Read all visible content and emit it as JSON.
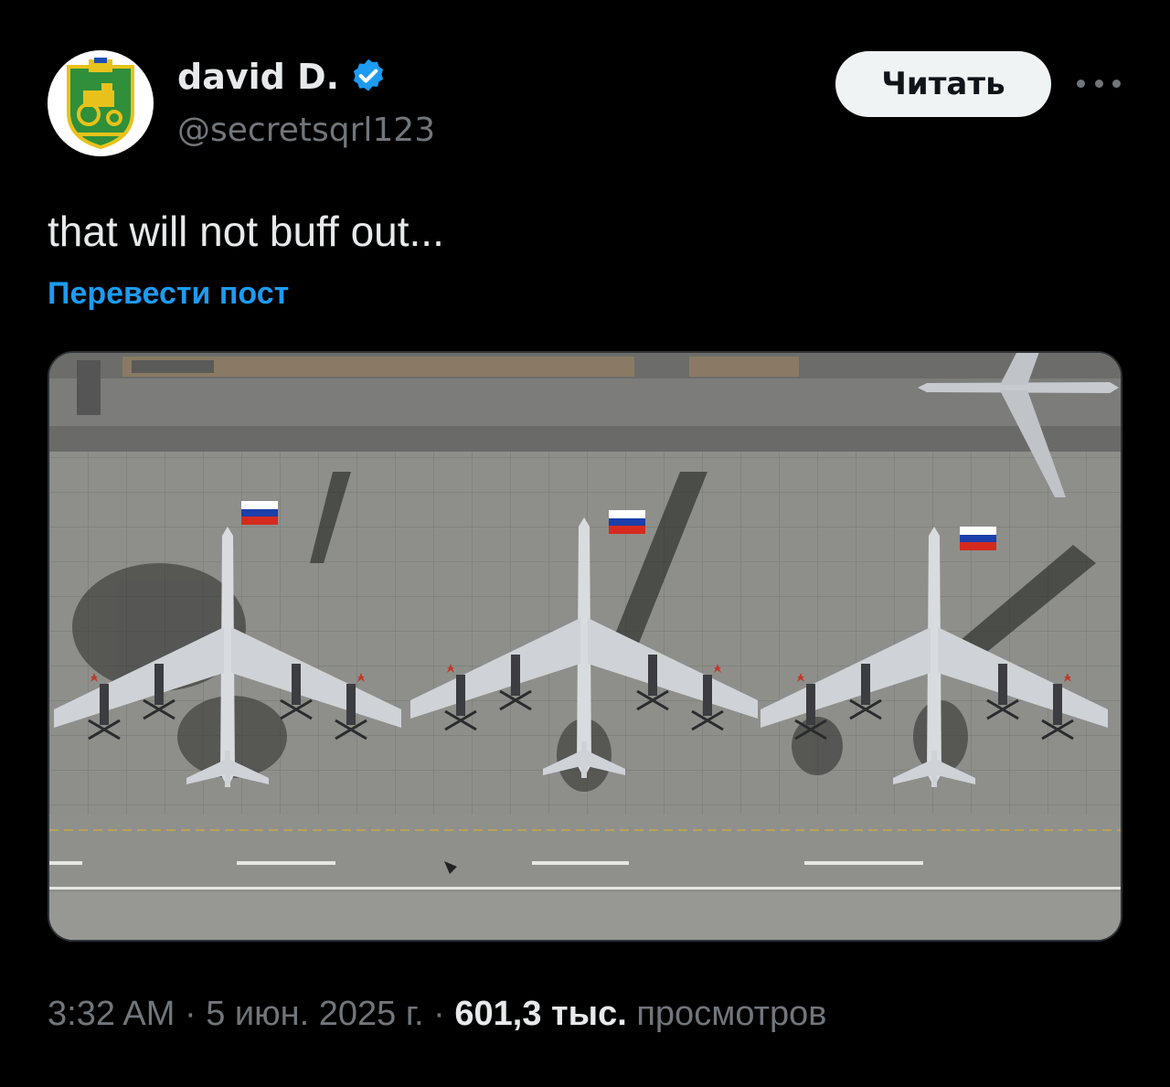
{
  "author": {
    "name": "david D.",
    "handle": "@secretsqrl123",
    "verified_color": "#1d9bf0"
  },
  "follow_button": {
    "label": "Читать"
  },
  "more_button": {
    "icon": "more-horizontal-icon"
  },
  "post": {
    "text": "that will not buff out...",
    "translate_label": "Перевести пост"
  },
  "meta": {
    "time": "3:32 AM",
    "separator": "·",
    "date": "5 июн. 2025 г.",
    "views_count": "601,3 тыс.",
    "views_label": "просмотров"
  },
  "colors": {
    "background": "#000000",
    "primary_text": "#e7e9ea",
    "secondary_text": "#71767b",
    "link": "#1d9bf0",
    "button_bg": "#eff3f4"
  }
}
